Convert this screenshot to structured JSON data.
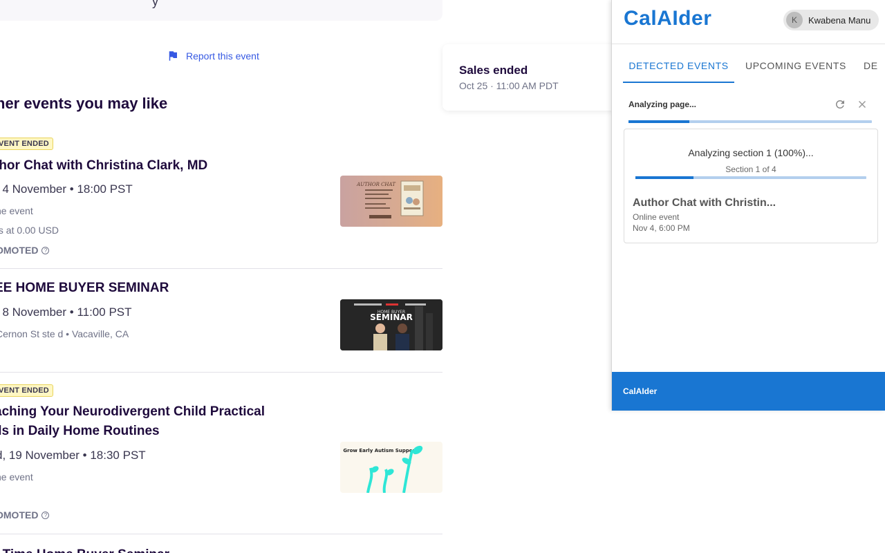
{
  "left": {
    "top_text": "y",
    "report_label": "Report this event",
    "section_title": "her events you may like",
    "events": [
      {
        "badge": "VENT ENDED",
        "title": "thor Chat with Christina Clark, MD",
        "date": ", 4 November • 18:00 PST",
        "location": "ne event",
        "price": "ts at 0.00 USD",
        "promoted": "OMOTED"
      },
      {
        "title": "EE HOME BUYER SEMINAR",
        "date": ", 8 November • 11:00 PST",
        "location": "Cernon St ste d • Vacaville, CA",
        "extra": "."
      },
      {
        "badge": "VENT ENDED",
        "title_line1": "aching Your Neurodivergent Child Practical",
        "title_line2": "lls in Daily Home Routines",
        "date": "d, 19 November • 18:30 PST",
        "location": "ne event",
        "extra": ".",
        "promoted": "OMOTED",
        "thumb_text": "Grow Early Autism Supports"
      },
      {
        "title": "t Time Home Buyer Seminar"
      }
    ],
    "sales": {
      "title": "Sales ended",
      "date": "Oct 25 · 11:00 AM PDT"
    },
    "thumb_labels": {
      "seminar_heading": "SEMINAR",
      "seminar_sub": "HOME BUYER",
      "author_heading": "AUTHOR CHAT"
    }
  },
  "panel": {
    "brand": "CalAIder",
    "user": {
      "initial": "K",
      "name": "Kwabena Manu"
    },
    "tabs": [
      "DETECTED EVENTS",
      "UPCOMING EVENTS",
      "DE"
    ],
    "analyzing_label": "Analyzing page...",
    "page_progress": 0.25,
    "section": {
      "title": "Analyzing section 1 (100%)...",
      "subtitle": "Section 1 of 4",
      "progress": 0.25
    },
    "event": {
      "name": "Author Chat with Christin...",
      "location": "Online event",
      "when": "Nov 4, 6:00 PM"
    },
    "footer": "CalAIder"
  },
  "colors": {
    "accent": "#1976d2",
    "link": "#3659e3",
    "badge_bg": "#fff7c4"
  }
}
